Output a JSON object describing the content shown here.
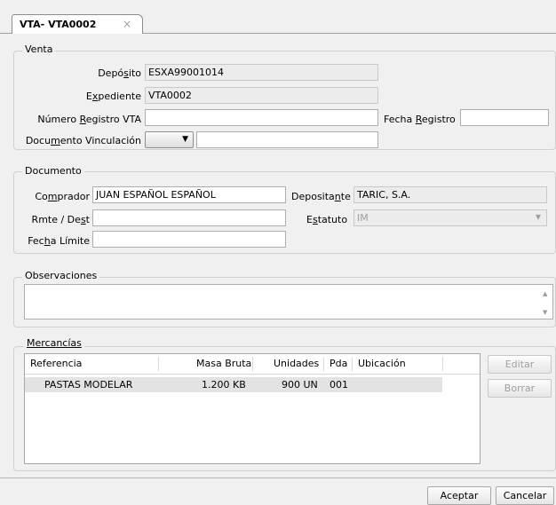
{
  "tab": {
    "title": "VTA- VTA0002",
    "close": "×"
  },
  "venta": {
    "title": "Venta",
    "deposito_label": "Depósito",
    "deposito_value": "ESXA99001014",
    "expediente_label": "Expediente",
    "expediente_value": "VTA0002",
    "numero_registro_label": "Número Registro VTA",
    "numero_registro_value": "",
    "fecha_registro_label": "Fecha Registro",
    "fecha_registro_value": "",
    "doc_vinculacion_label": "Documento Vinculación",
    "doc_vinculacion_value": ""
  },
  "documento": {
    "title": "Documento",
    "comprador_label": "Comprador",
    "comprador_value": "JUAN ESPAÑOL ESPAÑOL",
    "depositante_label": "Depositante",
    "depositante_value": "TARIC, S.A.",
    "rmte_label": "Rmte / Dest",
    "rmte_value": "",
    "estatuto_label": "Estatuto",
    "estatuto_value": "IM",
    "fecha_limite_label": "Fecha Límite",
    "fecha_limite_value": ""
  },
  "observaciones": {
    "title": "Observaciones",
    "value": ""
  },
  "mercancias": {
    "title": "Mercancías",
    "columns": [
      "Referencia",
      "Masa Bruta",
      "Unidades",
      "Pda",
      "Ubicación"
    ],
    "rows": [
      {
        "referencia": "PASTAS MODELAR",
        "masa_bruta": "1.200 KB",
        "unidades": "900 UN",
        "pda": "001",
        "ubicacion": ""
      }
    ],
    "editar_label": "Editar",
    "borrar_label": "Borrar"
  },
  "footer": {
    "aceptar_label": "Aceptar",
    "cancelar_label": "Cancelar"
  },
  "colors": {
    "selected_row": "#e3e3e3",
    "disabled_text": "#a0a0a0"
  }
}
